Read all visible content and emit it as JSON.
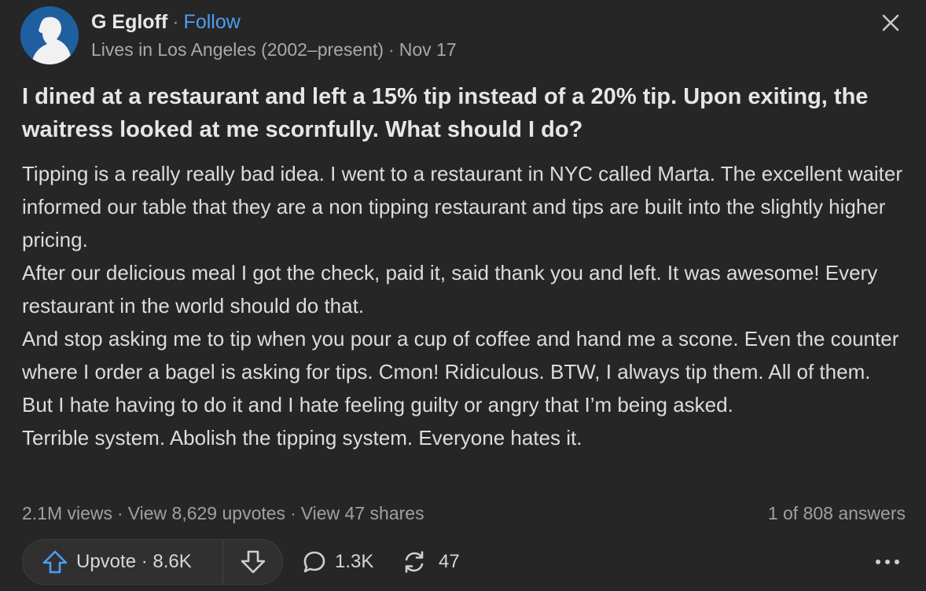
{
  "author": {
    "name": "G Egloff",
    "follow_label": "Follow",
    "credential": "Lives in Los Angeles (2002–present)",
    "date": "Nov 17",
    "separator": "·"
  },
  "question": {
    "title": "I dined at a restaurant and left a 15% tip instead of a 20% tip. Upon exiting, the waitress looked at me scornfully. What should I do?"
  },
  "answer": {
    "paragraphs": [
      "Tipping is a really really bad idea. I went to a restaurant in NYC called Marta. The excellent waiter informed our table that they are a non tipping restaurant and tips are built into the slightly higher pricing.",
      "After our delicious meal I got the check, paid it, said thank you and left. It was awesome! Every restaurant in the world should do that.",
      "And stop asking me to tip when you pour a cup of coffee and hand me a scone. Even the counter where I order a bagel is asking for tips. Cmon! Ridiculous. BTW, I always tip them. All of them. But I hate having to do it and I hate feeling guilty or angry that I’m being asked.",
      "Terrible system. Abolish the tipping system. Everyone hates it."
    ]
  },
  "stats": {
    "views": "2.1M views",
    "upvotes_link": "View 8,629 upvotes",
    "shares_link": "View 47 shares",
    "answer_position": "1 of 808 answers",
    "separator": "·"
  },
  "actions": {
    "upvote_label": "Upvote · 8.6K",
    "comments_count": "1.3K",
    "shares_count": "47"
  },
  "icons": {
    "close": "close-icon",
    "upvote": "arrow-up-icon",
    "downvote": "arrow-down-icon",
    "comment": "comment-bubble-icon",
    "share": "share-cycle-icon",
    "more": "more-dots-icon"
  },
  "colors": {
    "background": "#262626",
    "accent": "#4f9cf5",
    "text": "#dcdcdc",
    "muted": "#a0a0a0",
    "avatar": "#1f5fa0"
  }
}
